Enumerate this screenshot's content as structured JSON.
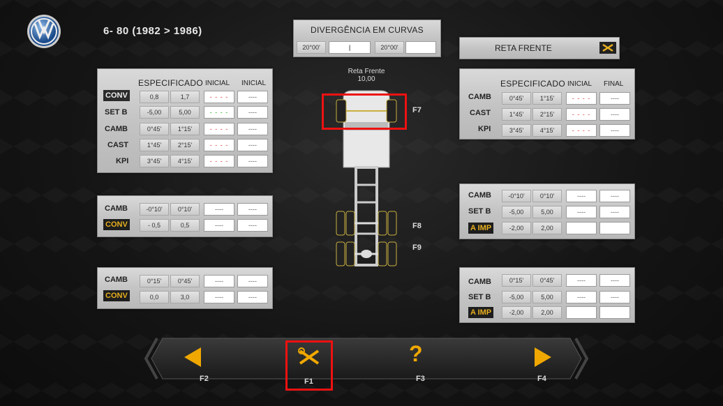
{
  "header": {
    "model": "6- 80  (1982 > 1986)"
  },
  "divergence": {
    "title": "DIVERGÊNCIA EM CURVAS",
    "left_value": "20°00'",
    "left_input": "|",
    "right_value": "20°00'",
    "right_input": ""
  },
  "reta_frente": {
    "label": "RETA FRENTE",
    "caption": "Reta Frente",
    "value": "10,00"
  },
  "left_front": {
    "headers": [
      "ESPECIFICADO",
      "INICIAL",
      "INICIAL"
    ],
    "rows": [
      {
        "label": "CONV",
        "min": "0,8",
        "max": "1,7",
        "a": "- - - -",
        "b": "----"
      },
      {
        "label": "SET B",
        "min": "-5,00",
        "max": "5,00",
        "a": "- - - -",
        "b": "----"
      },
      {
        "label": "CAMB",
        "min": "0°45'",
        "max": "1°15'",
        "a": "- - - -",
        "b": "----"
      },
      {
        "label": "CAST",
        "min": "1°45'",
        "max": "2°15'",
        "a": "- - - -",
        "b": "----"
      },
      {
        "label": "KPI",
        "min": "3°45'",
        "max": "4°15'",
        "a": "- - - -",
        "b": "----"
      }
    ]
  },
  "right_front": {
    "headers": [
      "ESPECIFICADO",
      "INICIAL",
      "FINAL"
    ],
    "rows": [
      {
        "label": "CAMB",
        "min": "0°45'",
        "max": "1°15'",
        "a": "- - - -",
        "b": "----"
      },
      {
        "label": "CAST",
        "min": "1°45'",
        "max": "2°15'",
        "a": "- - - -",
        "b": "----"
      },
      {
        "label": "KPI",
        "min": "3°45'",
        "max": "4°15'",
        "a": "- - - -",
        "b": "----"
      }
    ]
  },
  "left_mid": {
    "rows": [
      {
        "label": "CAMB",
        "min": "-0°10'",
        "max": "0°10'",
        "a": "----",
        "b": "----"
      },
      {
        "label": "CONV",
        "min": "- 0,5",
        "max": "0,5",
        "a": "----",
        "b": "----"
      }
    ]
  },
  "left_bottom": {
    "rows": [
      {
        "label": "CAMB",
        "min": "0°15'",
        "max": "0°45'",
        "a": "----",
        "b": "----"
      },
      {
        "label": "CONV",
        "min": "0,0",
        "max": "3,0",
        "a": "----",
        "b": "----"
      }
    ]
  },
  "right_mid": {
    "rows": [
      {
        "label": "CAMB",
        "min": "-0°10'",
        "max": "0°10'",
        "a": "----",
        "b": "----"
      },
      {
        "label": "SET B",
        "min": "-5,00",
        "max": "5,00",
        "a": "----",
        "b": "----"
      },
      {
        "label": "A IMP",
        "min": "-2,00",
        "max": "2,00",
        "a": "",
        "b": ""
      }
    ]
  },
  "right_bottom": {
    "rows": [
      {
        "label": "CAMB",
        "min": "0°15'",
        "max": "0°45'",
        "a": "----",
        "b": "----"
      },
      {
        "label": "SET B",
        "min": "-5,00",
        "max": "5,00",
        "a": "----",
        "b": "----"
      },
      {
        "label": "A IMP",
        "min": "-2,00",
        "max": "2,00",
        "a": "",
        "b": ""
      }
    ]
  },
  "axles": {
    "f7": "F7",
    "f8": "F8",
    "f9": "F9"
  },
  "nav": {
    "back": "F2",
    "tools": "F1",
    "help": "F3",
    "next": "F4"
  },
  "colors": {
    "accent": "#f0a800",
    "highlight": "#e11111",
    "divergence_red": "#d33333",
    "divergence_green": "#22aa22"
  }
}
